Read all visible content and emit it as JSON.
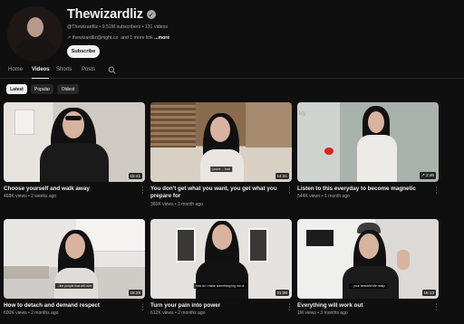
{
  "channel": {
    "name": "Thewizardliz",
    "handle_line": "@Thewizardliz • 9.51M subscribers • 131 videos",
    "link_text": "thewizardliz@night.co",
    "more_label": "...more",
    "subscribe_label": "Subscribe"
  },
  "tabs": [
    {
      "label": "Home"
    },
    {
      "label": "Videos"
    },
    {
      "label": "Shorts"
    },
    {
      "label": "Posts"
    }
  ],
  "filters": [
    {
      "label": "Latest"
    },
    {
      "label": "Popular"
    },
    {
      "label": "Oldest"
    }
  ],
  "videos": [
    {
      "title": "Choose yourself and walk away",
      "views": "468K views",
      "age": "2 weeks ago",
      "duration": "15:41",
      "caption": ""
    },
    {
      "title": "You don't get what you want, you get what you prepare for",
      "views": "366K views",
      "age": "1 month ago",
      "duration": "14:31",
      "caption": "you're ... had"
    },
    {
      "title": "Listen to this everyday to become magnetic",
      "views": "544K views",
      "age": "1 month ago",
      "duration": "2:46",
      "caption": ""
    },
    {
      "title": "How to detach and demand respect",
      "views": "600K views",
      "age": "2 months ago",
      "duration": "18:28",
      "caption": "...the people that will over"
    },
    {
      "title": "Turn your pain into power",
      "views": "612K views",
      "age": "2 months ago",
      "duration": "21:00",
      "caption": "how do I make something big out of..."
    },
    {
      "title": "Everything will work out",
      "views": "1M views",
      "age": "3 months ago",
      "duration": "15:13",
      "caption": "...your beautiful life really"
    }
  ],
  "colors": {
    "background": "#0f0f0f",
    "text_primary": "#f1f1f1",
    "text_secondary": "#aaaaaa",
    "chip_bg": "#272727"
  }
}
